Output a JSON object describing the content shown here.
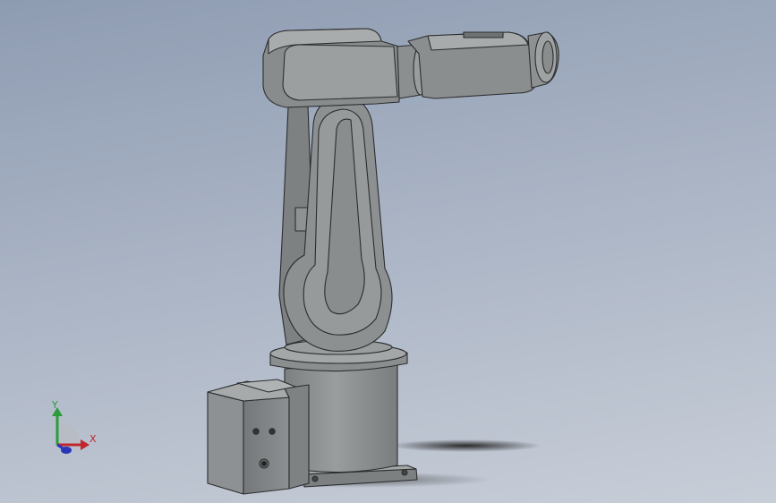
{
  "viewport": {
    "background_top": "#8e9cb2",
    "background_bottom": "#c8ced8"
  },
  "model": {
    "body_color": "#8a8d8e",
    "edge_color": "#2b2d2e"
  },
  "triad": {
    "x_label": "X",
    "y_label": "Y",
    "x_color": "#c0262c",
    "y_color": "#2c9b3a",
    "z_color": "#2836b8"
  }
}
